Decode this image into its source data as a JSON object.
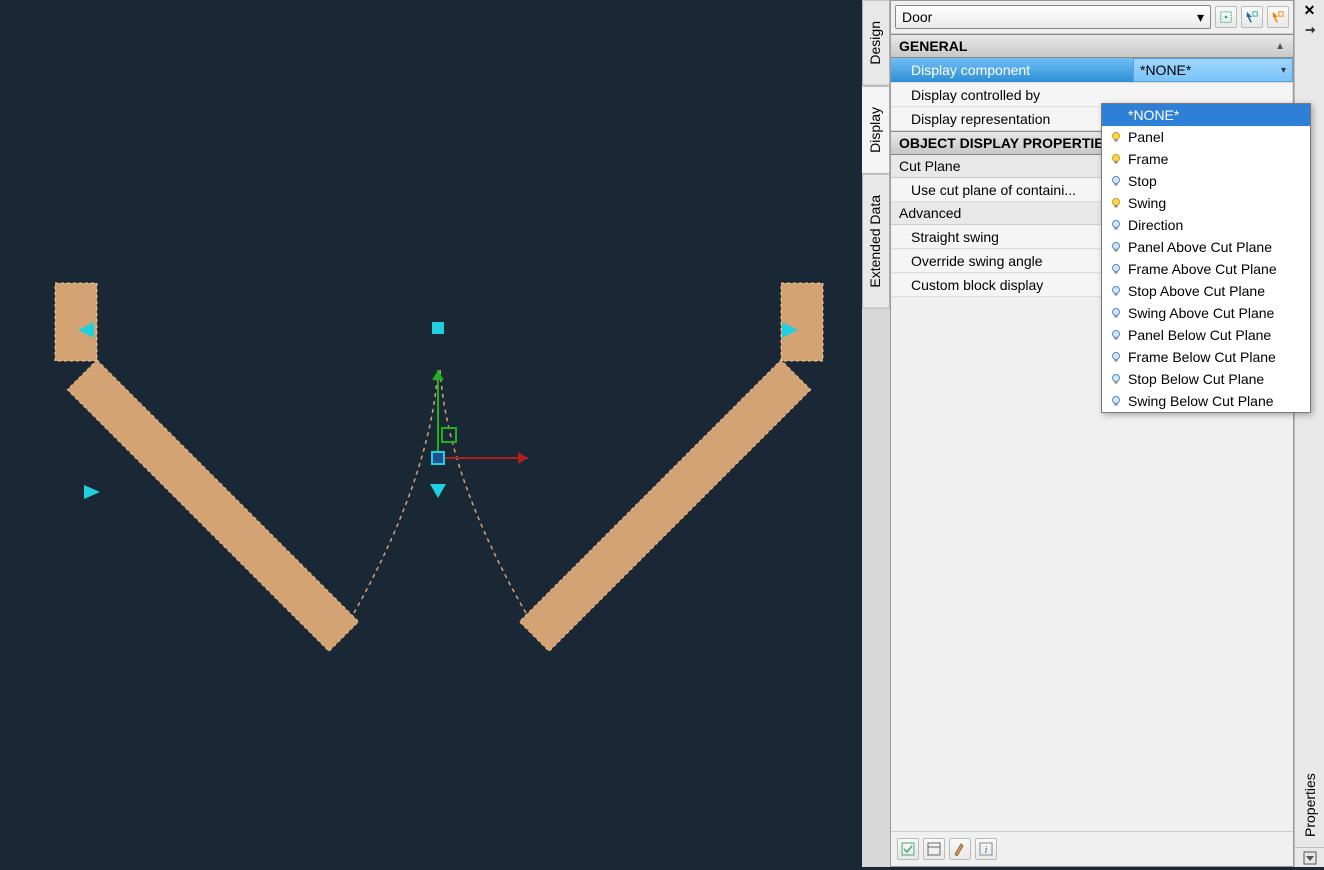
{
  "canvas": {
    "object_type": "Door"
  },
  "palette": {
    "title": "Properties",
    "side_tabs": [
      "Design",
      "Display",
      "Extended Data"
    ],
    "active_tab": "Display",
    "object_selector": "Door",
    "sections": {
      "general": {
        "header": "GENERAL",
        "rows": [
          {
            "label": "Display component",
            "value": "*NONE*",
            "highlight": true,
            "dropdown": true
          },
          {
            "label": "Display controlled by",
            "value": ""
          },
          {
            "label": "Display representation",
            "value": ""
          }
        ]
      },
      "object_display": {
        "header": "OBJECT DISPLAY PROPERTIES",
        "sub_cutplane": "Cut Plane",
        "cutplane_rows": [
          {
            "label": "Use cut plane of containi...",
            "value": ""
          }
        ],
        "sub_advanced": "Advanced",
        "advanced_rows": [
          {
            "label": "Straight swing",
            "value": ""
          },
          {
            "label": "Override swing angle",
            "value": ""
          },
          {
            "label": "Custom block display",
            "value": ""
          }
        ]
      }
    },
    "dropdown_options": [
      {
        "label": "*NONE*",
        "bulb": null,
        "selected": true
      },
      {
        "label": "Panel",
        "bulb": "on"
      },
      {
        "label": "Frame",
        "bulb": "on"
      },
      {
        "label": "Stop",
        "bulb": "off"
      },
      {
        "label": "Swing",
        "bulb": "on"
      },
      {
        "label": "Direction",
        "bulb": "off"
      },
      {
        "label": "Panel Above Cut Plane",
        "bulb": "off"
      },
      {
        "label": "Frame Above Cut Plane",
        "bulb": "off"
      },
      {
        "label": "Stop Above Cut Plane",
        "bulb": "off"
      },
      {
        "label": "Swing Above Cut Plane",
        "bulb": "off"
      },
      {
        "label": "Panel Below Cut Plane",
        "bulb": "off"
      },
      {
        "label": "Frame Below Cut Plane",
        "bulb": "off"
      },
      {
        "label": "Stop Below Cut Plane",
        "bulb": "off"
      },
      {
        "label": "Swing Below Cut Plane",
        "bulb": "off"
      }
    ]
  }
}
